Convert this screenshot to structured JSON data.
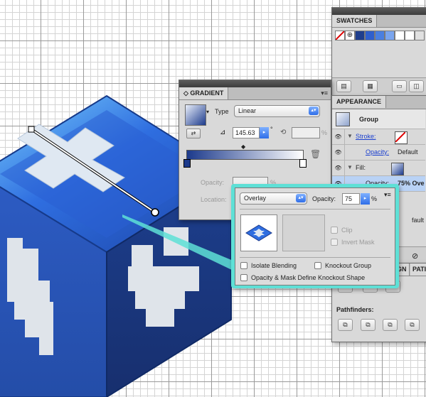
{
  "colors": {
    "cube_top": "#2f5fcc",
    "cube_left": "#2a56b8",
    "cube_right": "#1e3f8c",
    "highlight": "#5ee0d6",
    "accent_blue": "#2f6ee8"
  },
  "swatches_panel": {
    "title": "SWATCHES",
    "colors": [
      "#1f3e8c",
      "#2f5fcc",
      "#4a7fe0",
      "#7aa5ee",
      "#ffffff",
      "#ffffff",
      "#e0e0e0"
    ]
  },
  "gradient_panel": {
    "title": "GRADIENT",
    "type_label": "Type",
    "type_value": "Linear",
    "angle_value": "145.63",
    "degree_symbol": "°",
    "percent_symbol": "%",
    "opacity_label": "Opacity:",
    "location_label": "Location:",
    "percent_symbol_opacity": "%",
    "percent_symbol_location": "%"
  },
  "appearance_panel": {
    "title": "APPEARANCE",
    "group_label": "Group",
    "stroke_label": "Stroke:",
    "opacity_label": "Opacity:",
    "opacity_value": "Default",
    "fill_label": "Fill:",
    "fill_opacity_label": "Opacity:",
    "fill_opacity_value": "75% Ove",
    "bottom_value": "fault"
  },
  "transparency_popup": {
    "blend_mode": "Overlay",
    "opacity_label": "Opacity:",
    "opacity_value": "75",
    "percent_symbol": "%",
    "clip_label": "Clip",
    "invert_mask_label": "Invert Mask",
    "isolate_blending_label": "Isolate Blending",
    "knockout_group_label": "Knockout Group",
    "opacity_mask_label": "Opacity & Mask Define Knockout Shape"
  },
  "pathfinder_panel": {
    "tab_label_partial": "GN",
    "tab_label_2_partial": "PATI",
    "pathfinders_label": "Pathfinders:"
  }
}
